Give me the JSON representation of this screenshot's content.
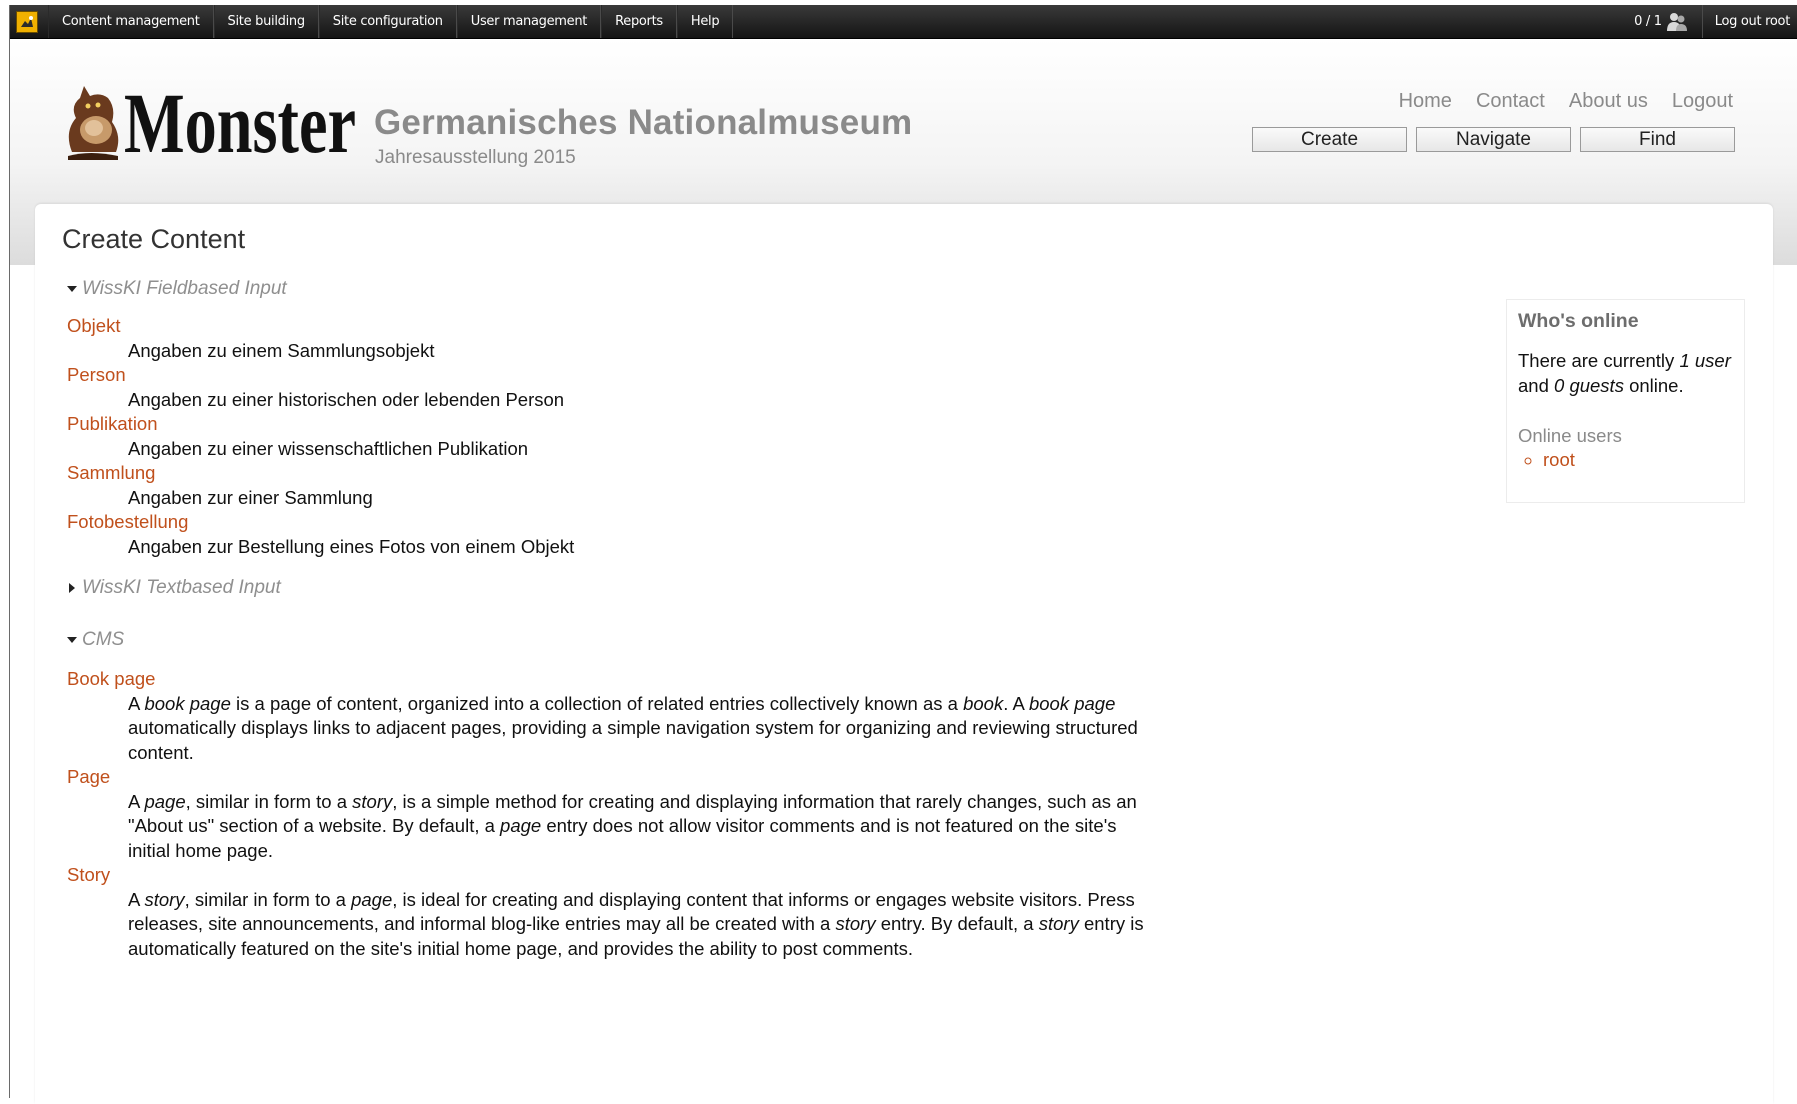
{
  "admin_bar": {
    "menu": [
      "Content management",
      "Site building",
      "Site configuration",
      "User management",
      "Reports",
      "Help"
    ],
    "online_counter": "0 / 1",
    "logout": "Log out root"
  },
  "header": {
    "logo_text": "Monster",
    "site_name": "Germanisches Nationalmuseum",
    "site_slogan": "Jahresausstellung 2015",
    "primary_links": [
      "Home",
      "Contact",
      "About us",
      "Logout"
    ],
    "buttons": [
      "Create",
      "Navigate",
      "Find"
    ]
  },
  "main": {
    "title": "Create Content",
    "fieldsets": [
      {
        "legend": "WissKI Fieldbased Input",
        "expanded": true,
        "types": [
          {
            "name": "Objekt",
            "description": "Angaben zu einem Sammlungsobjekt"
          },
          {
            "name": "Person",
            "description": "Angaben zu einer historischen oder lebenden Person"
          },
          {
            "name": "Publikation",
            "description": "Angaben zu einer wissenschaftlichen Publikation"
          },
          {
            "name": "Sammlung",
            "description": "Angaben zur einer Sammlung"
          },
          {
            "name": "Fotobestellung",
            "description": "Angaben zur Bestellung eines Fotos von einem Objekt"
          }
        ]
      },
      {
        "legend": "WissKI Textbased Input",
        "expanded": false,
        "types": []
      },
      {
        "legend": "CMS",
        "expanded": true,
        "types": [
          {
            "name": "Book page",
            "description": "A book page is a page of content, organized into a collection of related entries collectively known as a book. A book page automatically displays links to adjacent pages, providing a simple navigation system for organizing and reviewing structured content."
          },
          {
            "name": "Page",
            "description": "A page, similar in form to a story, is a simple method for creating and displaying information that rarely changes, such as an \"About us\" section of a website. By default, a page entry does not allow visitor comments and is not featured on the site's initial home page."
          },
          {
            "name": "Story",
            "description": "A story, similar in form to a page, is ideal for creating and displaying content that informs or engages website visitors. Press releases, site announcements, and informal blog-like entries may all be created with a story entry. By default, a story entry is automatically featured on the site's initial home page, and provides the ability to post comments."
          }
        ]
      }
    ]
  },
  "sidebar": {
    "whos_online": {
      "title": "Who's online",
      "text_prefix": "There are currently ",
      "users": "1 user",
      "text_mid": " and ",
      "guests": "0 guests",
      "text_suffix": " online.",
      "online_users_label": "Online users",
      "users_list": [
        "root"
      ]
    }
  },
  "colors": {
    "link": "#c0501c",
    "muted": "#8a8a8a",
    "toolbar": "#1a1a1a"
  }
}
